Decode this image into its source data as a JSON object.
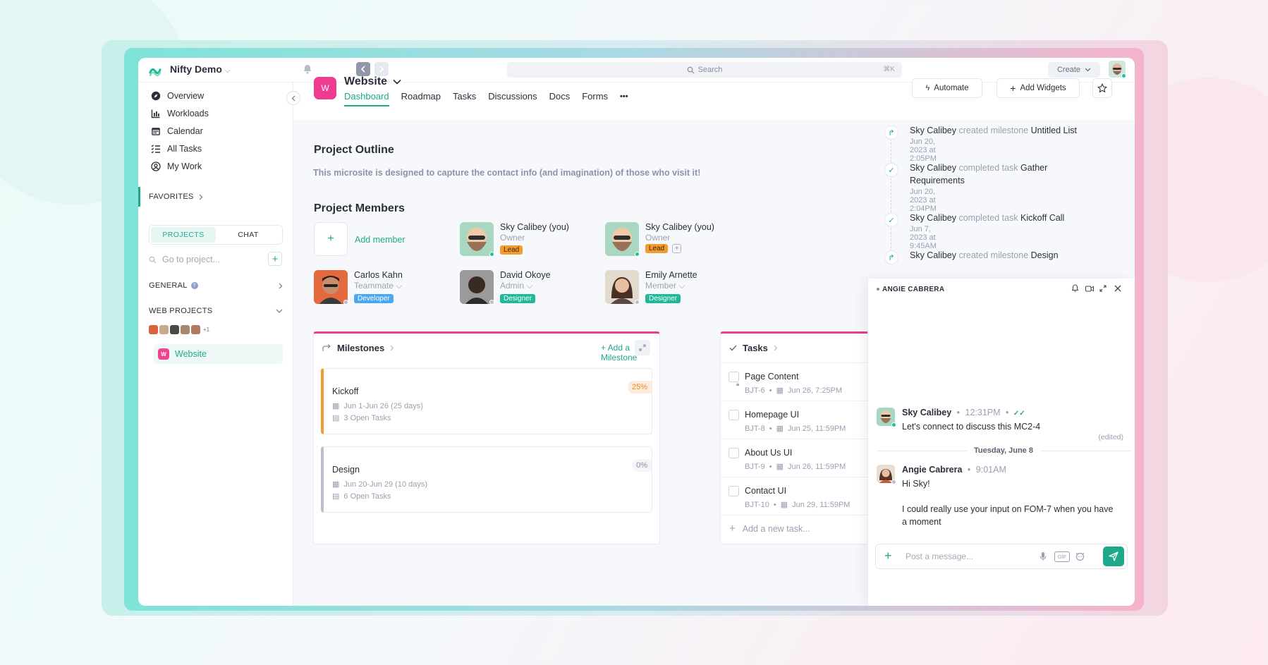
{
  "app": {
    "workspace": "Nifty Demo"
  },
  "topbar": {
    "search_placeholder": "Search",
    "search_shortcut": "⌘K",
    "create_label": "Create"
  },
  "sidebar": {
    "nav": [
      {
        "label": "Overview",
        "icon": "compass-icon"
      },
      {
        "label": "Workloads",
        "icon": "bar-chart-icon"
      },
      {
        "label": "Calendar",
        "icon": "calendar-icon"
      },
      {
        "label": "All Tasks",
        "icon": "list-icon"
      },
      {
        "label": "My Work",
        "icon": "user-icon"
      }
    ],
    "favorites_label": "FAVORITES",
    "tabs": {
      "projects": "PROJECTS",
      "chat": "CHAT"
    },
    "go_to_project_placeholder": "Go to project...",
    "general_label": "GENERAL",
    "web_projects_label": "WEB PROJECTS",
    "avatars_more": "+1",
    "project_item": {
      "badge": "W",
      "label": "Website"
    }
  },
  "project": {
    "badge": "W",
    "title": "Website",
    "tabs": [
      "Dashboard",
      "Roadmap",
      "Tasks",
      "Discussions",
      "Docs",
      "Forms"
    ],
    "more": "•••",
    "automate_label": "Automate",
    "add_widgets_label": "Add Widgets"
  },
  "outline": {
    "title": "Project Outline",
    "description": "This microsite is designed to capture the contact info (and imagination) of those who visit it!"
  },
  "members": {
    "title": "Project Members",
    "add_label": "Add member",
    "list": [
      {
        "name": "Sky Calibey (you)",
        "role": "Owner",
        "tag": "Lead",
        "tag_color": "#f39c2b"
      },
      {
        "name": "Sky Calibey (you)",
        "role": "Owner",
        "tag": "Lead",
        "tag_color": "#f39c2b"
      },
      {
        "name": "Carlos Kahn",
        "role": "Teammate",
        "tag": "Developer",
        "tag_color": "#4aa8f0"
      },
      {
        "name": "David Okoye",
        "role": "Admin",
        "tag": "Designer",
        "tag_color": "#1fb89a"
      },
      {
        "name": "Emily Arnette",
        "role": "Member",
        "tag": "Designer",
        "tag_color": "#1fb89a"
      }
    ]
  },
  "milestones": {
    "title": "Milestones",
    "add_label": "+ Add a Milestone",
    "items": [
      {
        "title": "Kickoff",
        "dates": "Jun 1-Jun 26 (25 days)",
        "open_tasks": "3 Open Tasks",
        "progress": "25%",
        "accent": "#f39c2b"
      },
      {
        "title": "Design",
        "dates": "Jun 20-Jun 29 (10 days)",
        "open_tasks": "6 Open Tasks",
        "progress": "0%",
        "accent": "#b9bfcf"
      }
    ]
  },
  "tasks": {
    "title": "Tasks",
    "items": [
      {
        "name": "Page Content",
        "id": "BJT-6",
        "due": "Jun 26, 7:25PM"
      },
      {
        "name": "Homepage UI",
        "id": "BJT-8",
        "due": "Jun 25, 11:59PM"
      },
      {
        "name": "About Us UI",
        "id": "BJT-9",
        "due": "Jun 26, 11:59PM"
      },
      {
        "name": "Contact UI",
        "id": "BJT-10",
        "due": "Jun 29, 11:59PM"
      }
    ],
    "add_label": "Add a new task..."
  },
  "activity": [
    {
      "actor": "Sky Calibey",
      "verb": "created milestone",
      "object": "Untitled List",
      "time": "Jun 20, 2023 at 2:05PM"
    },
    {
      "actor": "Sky Calibey",
      "verb": "completed task",
      "object": "Gather Requirements",
      "time": "Jun 20, 2023 at 2:04PM"
    },
    {
      "actor": "Sky Calibey",
      "verb": "completed task",
      "object": "Kickoff Call",
      "time": "Jun 7, 2023 at 9:45AM"
    },
    {
      "actor": "Sky Calibey",
      "verb": "created milestone",
      "object": "Design",
      "time": ""
    }
  ],
  "chat": {
    "header": "ANGIE CABRERA",
    "messages": [
      {
        "author": "Sky Calibey",
        "time": "12:31PM",
        "text": "Let's connect to discuss this MC2-4",
        "edited": "(edited)"
      },
      {
        "author": "Angie Cabrera",
        "time": "9:01AM",
        "text1": "Hi Sky!",
        "text2": "I could really use your input on FOM-7 when you have a moment"
      }
    ],
    "day_separator": "Tuesday, June 8",
    "composer_placeholder": "Post a message...",
    "gif_label": "GIF"
  }
}
